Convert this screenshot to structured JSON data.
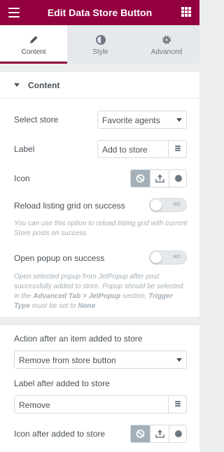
{
  "header": {
    "title": "Edit Data Store Button",
    "menu_icon": "hamburger-menu-icon",
    "apps_icon": "grid-apps-icon"
  },
  "tabs": [
    {
      "label": "Content",
      "icon": "pencil-icon",
      "active": true
    },
    {
      "label": "Style",
      "icon": "half-circle-icon",
      "active": false
    },
    {
      "label": "Advanced",
      "icon": "gear-icon",
      "active": false
    }
  ],
  "section": {
    "title": "Content"
  },
  "fields": {
    "select_store": {
      "label": "Select store",
      "value": "Favorite agents"
    },
    "label": {
      "label": "Label",
      "value": "Add to store"
    },
    "icon": {
      "label": "Icon"
    },
    "reload": {
      "label": "Reload listing grid on success",
      "toggle": "NO",
      "description": "You can use this option to reload listing grid with current Store posts on success"
    },
    "popup": {
      "label": "Open popup on success",
      "toggle": "NO",
      "desc_part1": "Open selected popup from JetPopup after post successfully added to store. Popup should be selected in the ",
      "desc_bold1": "Advanced Tab > JetPopup",
      "desc_part2": " section, ",
      "desc_bold2": "Trigger Type",
      "desc_part3": " must be set to ",
      "desc_bold3": "None"
    },
    "action_after": {
      "label": "Action after an item added to store",
      "value": "Remove from store button"
    },
    "label_after": {
      "label": "Label after added to store",
      "value": "Remove"
    },
    "icon_after": {
      "label": "Icon after added to store"
    }
  },
  "colors": {
    "accent": "#93003f",
    "panel_bg": "#eceeef"
  }
}
